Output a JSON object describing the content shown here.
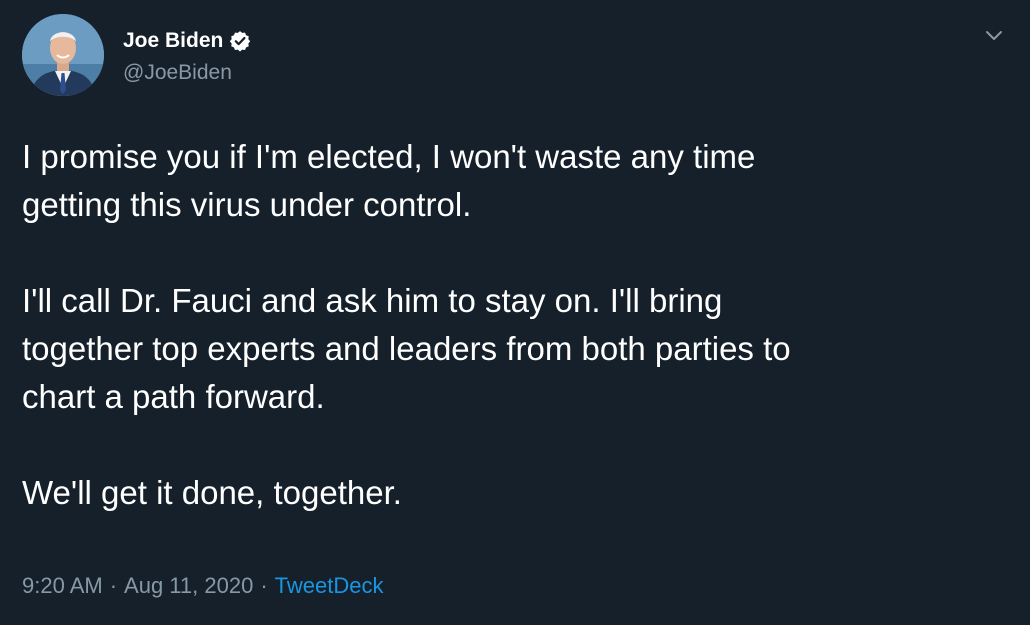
{
  "author": {
    "display_name": "Joe Biden",
    "handle": "@JoeBiden",
    "verified": true,
    "avatar_icon": "profile-photo"
  },
  "tweet": {
    "paragraphs": [
      "I promise you if I'm elected, I won't waste any time\ngetting this virus under control.",
      "I'll call Dr. Fauci and ask him to stay on. I'll bring\ntogether top experts and leaders from both parties to\nchart a path forward.",
      "We'll get it done, together."
    ]
  },
  "meta": {
    "time": "9:20 AM",
    "separator": "·",
    "date": "Aug 11, 2020",
    "source": "TweetDeck"
  },
  "icons": {
    "verified": "verified-badge-icon",
    "menu": "chevron-down-icon"
  },
  "colors": {
    "background": "#15202b",
    "secondary_text": "#8899a6",
    "link": "#1b95e0"
  }
}
